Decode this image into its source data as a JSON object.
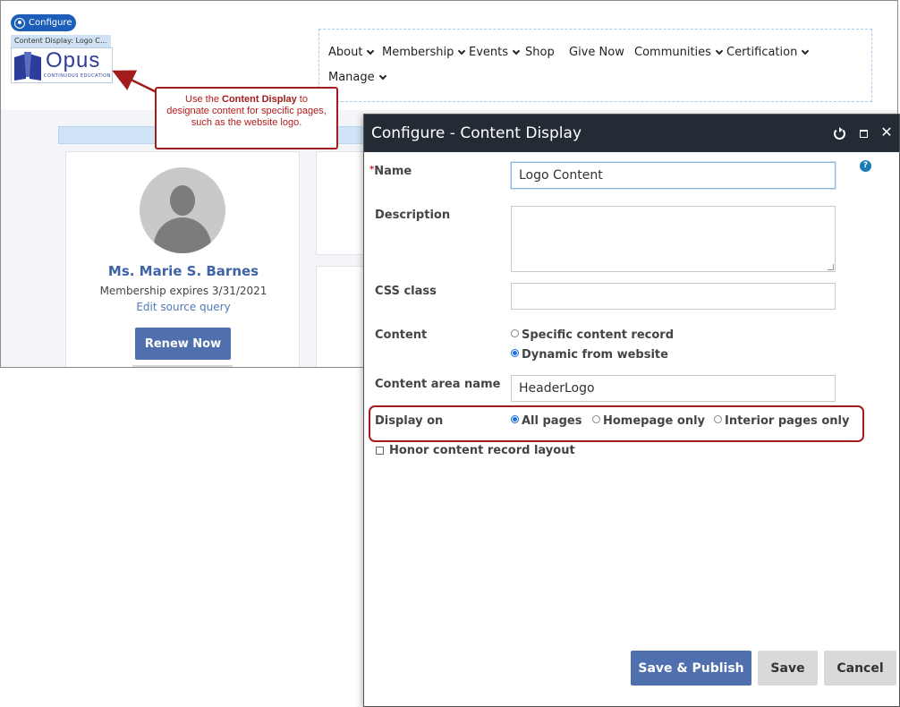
{
  "site": {
    "configure_label": "Configure",
    "content_display_label": "Content Display: Logo C...",
    "logo_text": "Opus",
    "logo_subtext": "CONTINUOUS   EDUCATION",
    "nav": [
      {
        "label": "About",
        "has_dropdown": true
      },
      {
        "label": "Membership",
        "has_dropdown": true
      },
      {
        "label": "Events",
        "has_dropdown": true
      },
      {
        "label": "Shop",
        "has_dropdown": false
      },
      {
        "label": "Give Now",
        "has_dropdown": false
      },
      {
        "label": "Communities",
        "has_dropdown": true
      },
      {
        "label": "Certification",
        "has_dropdown": true
      },
      {
        "label": "Manage",
        "has_dropdown": true
      }
    ],
    "profile": {
      "name": "Ms. Marie S. Barnes",
      "membership": "Membership expires 3/31/2021",
      "edit_link": "Edit source query",
      "renew_button": "Renew Now"
    }
  },
  "callout": {
    "text_before": "Use the ",
    "text_bold": "Content Display",
    "text_after": " to designate content for specific pages, such as the website logo."
  },
  "dialog": {
    "title": "Configure - Content Display",
    "icons": {
      "refresh": "refresh-icon",
      "maximize": "maximize-icon",
      "close": "close-icon",
      "help": "help-icon"
    },
    "close_glyph": "✕",
    "help_glyph": "?",
    "fields": {
      "name_label": "Name",
      "name_value": "Logo Content",
      "description_label": "Description",
      "description_value": "",
      "css_label": "CSS class",
      "css_value": "",
      "content_label": "Content",
      "content_options": [
        "Specific content record",
        "Dynamic from website"
      ],
      "content_selected": "Dynamic from website",
      "area_label": "Content area name",
      "area_value": "HeaderLogo",
      "display_label": "Display on",
      "display_options": [
        "All pages",
        "Homepage only",
        "Interior pages only"
      ],
      "display_selected": "All pages",
      "honor_label": "Honor content record layout",
      "honor_checked": false
    },
    "buttons": {
      "save_publish": "Save & Publish",
      "save": "Save",
      "cancel": "Cancel"
    }
  },
  "colors": {
    "accent": "#4f6fae",
    "callout": "#a31c1c",
    "titlebar": "#232b34"
  }
}
